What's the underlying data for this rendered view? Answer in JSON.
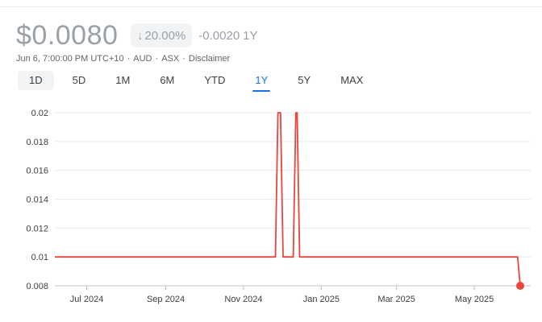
{
  "quote": {
    "price": "$0.0080",
    "change_pct": "20.00%",
    "change_abs": "-0.0020",
    "change_period": "1Y",
    "arrow_icon": "arrow-down-icon"
  },
  "meta": {
    "timestamp": "Jun 6, 7:00:00 PM UTC+10",
    "currency": "AUD",
    "exchange": "ASX",
    "disclaimer": "Disclaimer"
  },
  "tabs": [
    {
      "label": "1D"
    },
    {
      "label": "5D"
    },
    {
      "label": "1M"
    },
    {
      "label": "6M"
    },
    {
      "label": "YTD"
    },
    {
      "label": "1Y",
      "active": true
    },
    {
      "label": "5Y"
    },
    {
      "label": "MAX"
    }
  ],
  "colors": {
    "line": "#e8453c",
    "grid": "#e8eaed",
    "active_tab": "#1a73e8"
  },
  "chart_data": {
    "type": "line",
    "title": "",
    "xlabel": "",
    "ylabel": "",
    "grid": true,
    "ylim": [
      0.008,
      0.02
    ],
    "xlim": [
      "2024-06-06",
      "2025-06-06"
    ],
    "y_ticks": [
      "0.02",
      "0.018",
      "0.016",
      "0.014",
      "0.012",
      "0.01",
      "0.008"
    ],
    "x_ticks": [
      {
        "label": "Jul 2024",
        "date": "2024-07-01"
      },
      {
        "label": "Sep 2024",
        "date": "2024-09-01"
      },
      {
        "label": "Nov 2024",
        "date": "2024-11-01"
      },
      {
        "label": "Jan 2025",
        "date": "2025-01-01"
      },
      {
        "label": "Mar 2025",
        "date": "2025-03-01"
      },
      {
        "label": "May 2025",
        "date": "2025-05-01"
      }
    ],
    "series": [
      {
        "points": [
          [
            "2024-06-06",
            0.01
          ],
          [
            "2024-11-26",
            0.01
          ],
          [
            "2024-11-28",
            0.02
          ],
          [
            "2024-11-30",
            0.02
          ],
          [
            "2024-12-02",
            0.01
          ],
          [
            "2024-12-10",
            0.01
          ],
          [
            "2024-12-12",
            0.02
          ],
          [
            "2024-12-13",
            0.02
          ],
          [
            "2024-12-15",
            0.01
          ],
          [
            "2025-06-04",
            0.01
          ],
          [
            "2025-06-06",
            0.008
          ]
        ]
      }
    ],
    "last_point": [
      "2025-06-06",
      0.008
    ]
  }
}
